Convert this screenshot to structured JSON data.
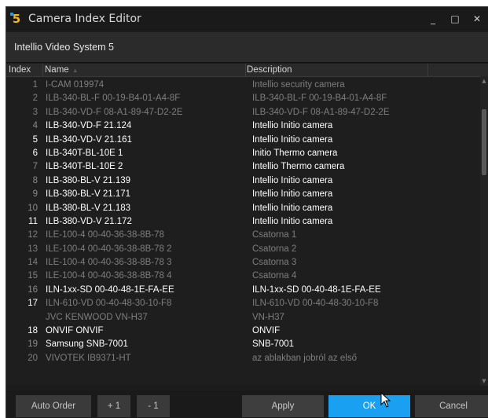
{
  "window": {
    "title": "Camera Index Editor",
    "subtitle": "Intellio Video System 5",
    "controls": {
      "minimize": "_",
      "maximize": "□",
      "close": "✕"
    }
  },
  "table": {
    "columns": {
      "index": "Index",
      "name": "Name",
      "description": "Description"
    },
    "rows": [
      {
        "index": "1",
        "name": "I-CAM 019974",
        "description": "Intellio security camera",
        "style": "dim"
      },
      {
        "index": "2",
        "name": "ILB-340-BL-F 00-19-B4-01-A4-8F",
        "description": "ILB-340-BL-F 00-19-B4-01-A4-8F",
        "style": "dim"
      },
      {
        "index": "3",
        "name": "ILB-340-VD-F 08-A1-89-47-D2-2E",
        "description": "ILB-340-VD-F 08-A1-89-47-D2-2E",
        "style": "dim"
      },
      {
        "index": "4",
        "name": "ILB-340-VD-F 21.124",
        "description": "Intellio Initio camera",
        "style": "mid"
      },
      {
        "index": "5",
        "name": "ILB-340-VD-V 21.161",
        "description": "Intellio Initio camera",
        "style": "bright"
      },
      {
        "index": "6",
        "name": "ILB-340T-BL-10E 1",
        "description": "Initio Thermo camera",
        "style": "bright"
      },
      {
        "index": "7",
        "name": "ILB-340T-BL-10E 2",
        "description": "Intellio Thermo camera",
        "style": "mid"
      },
      {
        "index": "8",
        "name": "ILB-380-BL-V 21.139",
        "description": "Intellio Initio camera",
        "style": "mid"
      },
      {
        "index": "9",
        "name": "ILB-380-BL-V 21.171",
        "description": "Intellio Initio camera",
        "style": "mid"
      },
      {
        "index": "10",
        "name": "ILB-380-BL-V 21.183",
        "description": "Intellio Initio camera",
        "style": "mid"
      },
      {
        "index": "11",
        "name": "ILB-380-VD-V 21.172",
        "description": "Intellio Initio camera",
        "style": "bright"
      },
      {
        "index": "12",
        "name": "ILE-100-4 00-40-36-38-8B-78",
        "description": "Csatorna 1",
        "style": "dim"
      },
      {
        "index": "13",
        "name": "ILE-100-4 00-40-36-38-8B-78 2",
        "description": "Csatorna 2",
        "style": "dim"
      },
      {
        "index": "14",
        "name": "ILE-100-4 00-40-36-38-8B-78 3",
        "description": "Csatorna 3",
        "style": "dim"
      },
      {
        "index": "15",
        "name": "ILE-100-4 00-40-36-38-8B-78 4",
        "description": "Csatorna 4",
        "style": "dim"
      },
      {
        "index": "16",
        "name": "ILN-1xx-SD 00-40-48-1E-FA-EE",
        "description": "ILN-1xx-SD 00-40-48-1E-FA-EE",
        "style": "mid"
      },
      {
        "index": "17",
        "name": "ILN-610-VD 00-40-48-30-10-F8",
        "description": "ILN-610-VD 00-40-48-30-10-F8",
        "style": "dim-bright-index"
      },
      {
        "index": "",
        "name": "JVC KENWOOD VN-H37",
        "description": "VN-H37",
        "style": "dim"
      },
      {
        "index": "18",
        "name": "ONVIF ONVIF",
        "description": "ONVIF",
        "style": "bright"
      },
      {
        "index": "19",
        "name": "Samsung SNB-7001",
        "description": "SNB-7001",
        "style": "mid"
      },
      {
        "index": "20",
        "name": "VIVOTEK IB9371-HT",
        "description": "az ablakban jobról az első",
        "style": "dim"
      }
    ]
  },
  "footer": {
    "auto_order": "Auto Order",
    "plus_one": "+ 1",
    "minus_one": "- 1",
    "apply": "Apply",
    "ok": "OK",
    "cancel": "Cancel"
  },
  "colors": {
    "accent": "#1aa0f0",
    "logo": "#f2b71f",
    "background": "#1c1c1c"
  }
}
